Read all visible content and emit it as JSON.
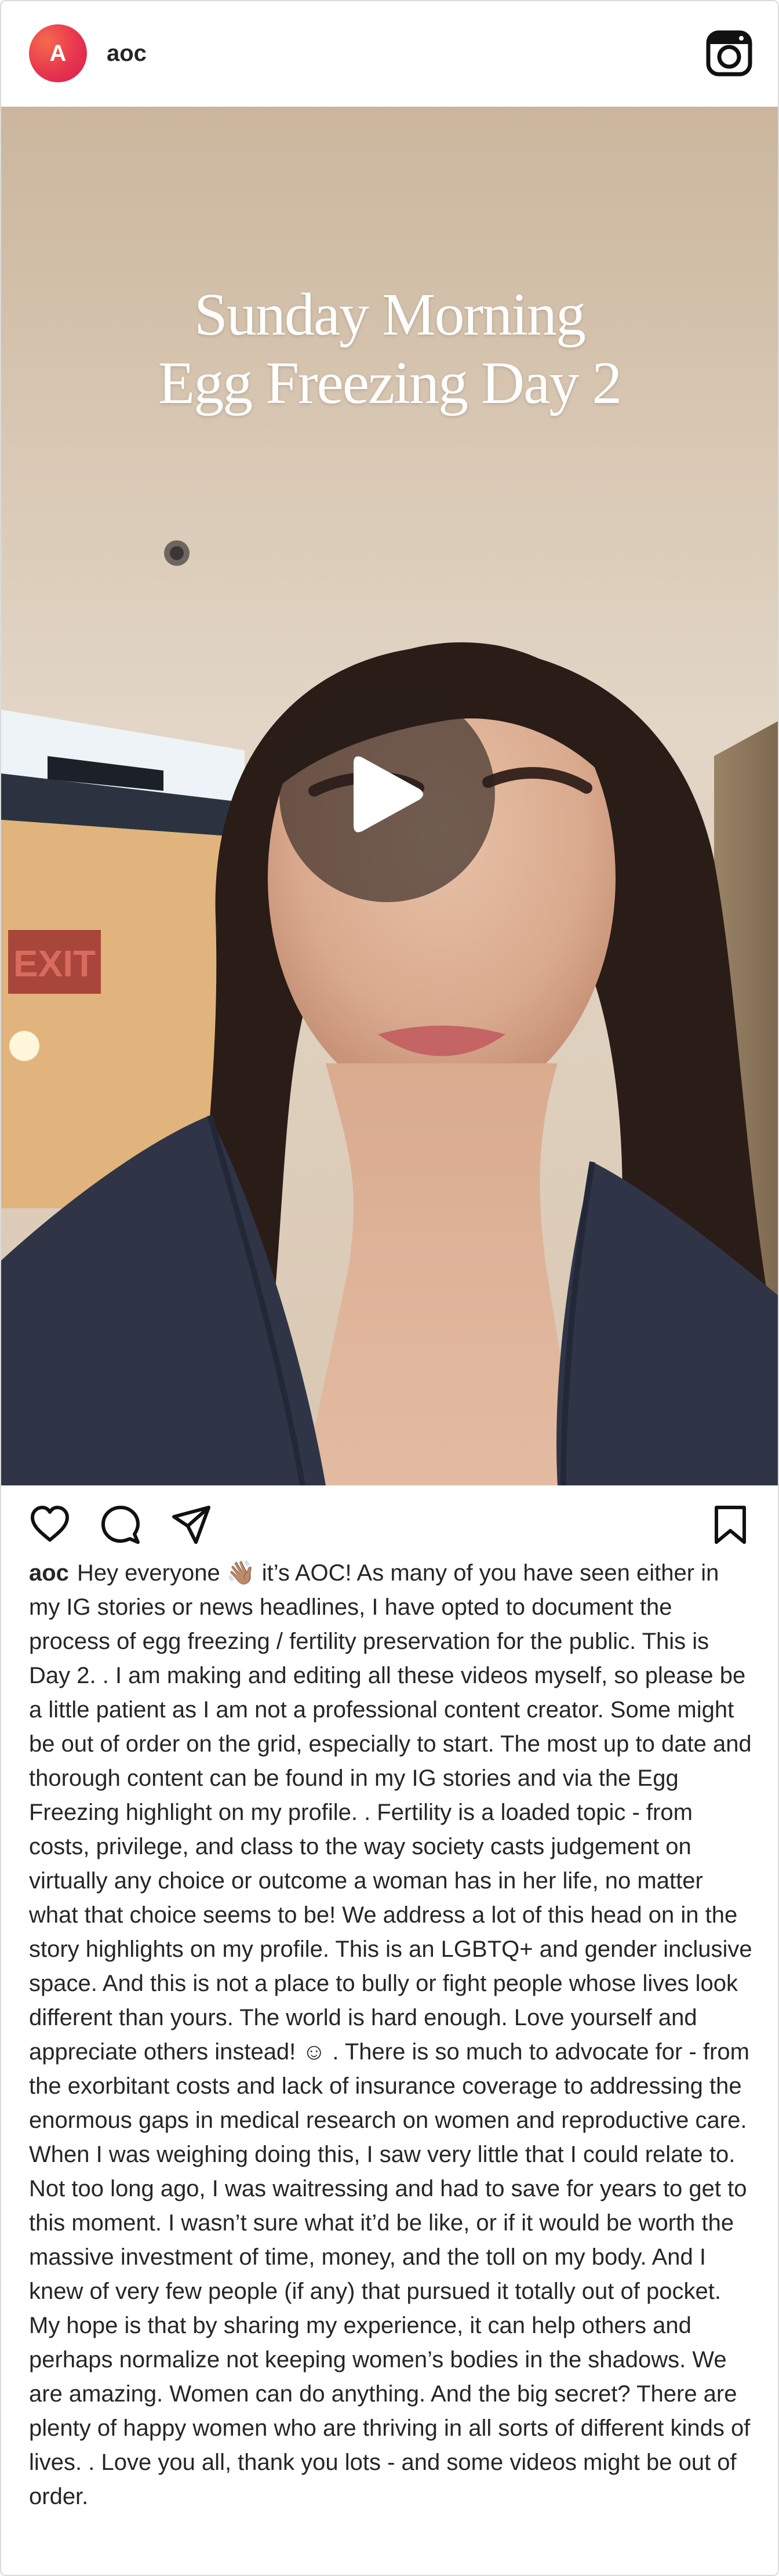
{
  "post": {
    "avatar_letter": "A",
    "username": "aoc",
    "media": {
      "overlay_line_1": "Sunday Morning",
      "overlay_line_2": "Egg Freezing Day 2",
      "exit_sign": "EXIT"
    },
    "caption": {
      "username": "aoc",
      "text": "Hey everyone 👋🏽 it’s AOC! As many of you have seen either in my IG stories or news headlines, I have opted to document the process of egg freezing / fertility preservation for the public. This is Day 2. . I am making and editing all these videos myself, so please be a little patient as I am not a professional content creator. Some might be out of order on the grid, especially to start. The most up to date and thorough content can be found in my IG stories and via the Egg Freezing highlight on my profile. . Fertility is a loaded topic - from costs, privilege, and class to the way society casts judgement on virtually any choice or outcome a woman has in her life, no matter what that choice seems to be! We address a lot of this head on in the story highlights on my profile. This is an LGBTQ+ and gender inclusive space. And this is not a place to bully or fight people whose lives look different than yours. The world is hard enough. Love yourself and appreciate others instead! ☺ . There is so much to advocate for - from the exorbitant costs and lack of insurance coverage to addressing the enormous gaps in medical research on women and reproductive care. When I was weighing doing this, I saw very little that I could relate to. Not too long ago, I was waitressing and had to save for years to get to this moment. I wasn’t sure what it’d be like, or if it would be worth the massive investment of time, money, and the toll on my body. And I knew of very few people (if any) that pursued it totally out of pocket. My hope is that by sharing my experience, it can help others and perhaps normalize not keeping women’s bodies in the shadows. We are amazing. Women can do anything. And the big secret? There are plenty of happy women who are thriving in all sorts of different kinds of lives. . Love you all, thank you lots - and some videos might be out of order."
    },
    "icons": {
      "header_right": "instagram-logo-icon",
      "play": "play-icon",
      "like": "heart-icon",
      "comment": "comment-icon",
      "share": "send-icon",
      "save": "bookmark-icon"
    },
    "colors": {
      "avatar_gradient_start": "#f46a4e",
      "avatar_gradient_end": "#d21f54",
      "text": "#262626",
      "border": "#dbdbdb"
    }
  }
}
